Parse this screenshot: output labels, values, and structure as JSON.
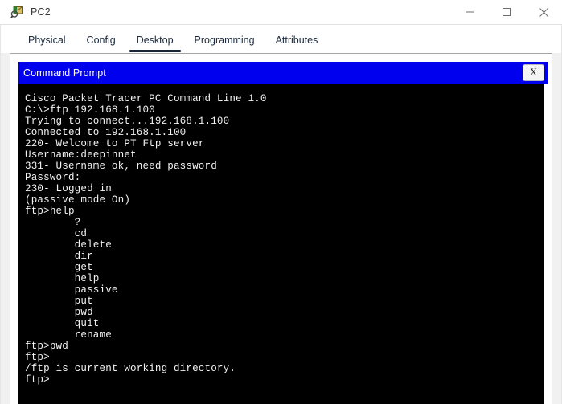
{
  "window": {
    "title": "PC2",
    "icon": "packet-tracer-pc-icon",
    "controls": {
      "minimize": "minimize-icon",
      "maximize": "maximize-icon",
      "close": "close-icon"
    }
  },
  "tabs": [
    {
      "label": "Physical",
      "active": false
    },
    {
      "label": "Config",
      "active": false
    },
    {
      "label": "Desktop",
      "active": true
    },
    {
      "label": "Programming",
      "active": false
    },
    {
      "label": "Attributes",
      "active": false
    }
  ],
  "command_prompt": {
    "title": "Command Prompt",
    "close_label": "X",
    "title_bg": "#0000ee",
    "terminal_bg": "#000000",
    "terminal_fg": "#f2f2f2",
    "lines": [
      "Cisco Packet Tracer PC Command Line 1.0",
      "C:\\>ftp 192.168.1.100",
      "Trying to connect...192.168.1.100",
      "Connected to 192.168.1.100",
      "220- Welcome to PT Ftp server",
      "Username:deepinnet",
      "331- Username ok, need password",
      "Password:",
      "230- Logged in",
      "(passive mode On)",
      "ftp>help",
      "        ?",
      "        cd",
      "        delete",
      "        dir",
      "        get",
      "        help",
      "        passive",
      "        put",
      "        pwd",
      "        quit",
      "        rename",
      "ftp>pwd",
      "ftp>",
      "/ftp is current working directory.",
      "ftp>"
    ]
  }
}
